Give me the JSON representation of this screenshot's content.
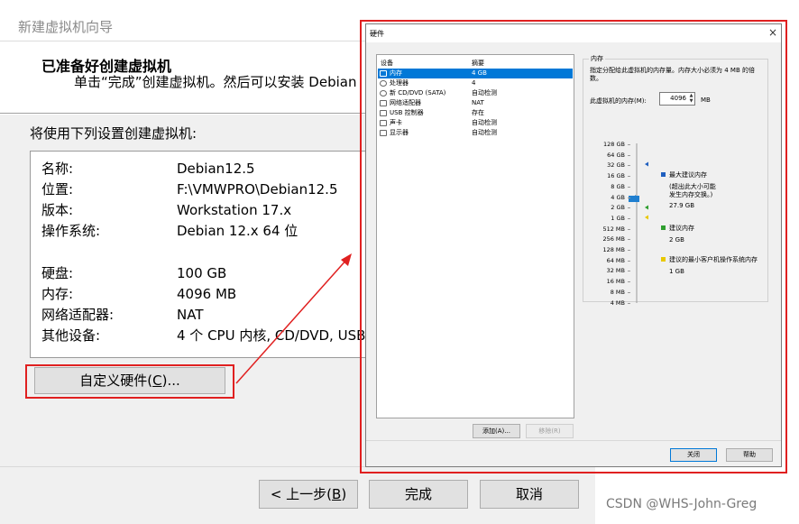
{
  "wizard": {
    "title": "新建虚拟机向导",
    "heading": "已准备好创建虚拟机",
    "subtitle": "单击“完成”创建虚拟机。然后可以安装 Debian",
    "prompt": "将使用下列设置创建虚拟机:",
    "summary": [
      {
        "key": "名称:",
        "value": "Debian12.5"
      },
      {
        "key": "位置:",
        "value": "F:\\VMWPRO\\Debian12.5"
      },
      {
        "key": "版本:",
        "value": "Workstation 17.x"
      },
      {
        "key": "操作系统:",
        "value": "Debian 12.x 64 位"
      },
      {
        "key": "硬盘:",
        "value": "100 GB"
      },
      {
        "key": "内存:",
        "value": "4096 MB"
      },
      {
        "key": "网络适配器:",
        "value": "NAT"
      },
      {
        "key": "其他设备:",
        "value": "4 个 CPU 内核, CD/DVD, USB"
      }
    ],
    "customize_button": {
      "label": "自定义硬件(",
      "mnemonic": "C",
      "suffix": ")..."
    },
    "back_button": {
      "label": "< 上一步(",
      "mnemonic": "B",
      "suffix": ")"
    },
    "finish_button": "完成",
    "cancel_button": "取消"
  },
  "watermark": "CSDN @WHS-John-Greg",
  "hardware_dialog": {
    "title": "硬件",
    "close_glyph": "×",
    "columns": {
      "device": "设备",
      "summary": "摘要"
    },
    "devices": [
      {
        "name": "内存",
        "summary": "4 GB",
        "icon": "memory-icon",
        "selected": true
      },
      {
        "name": "处理器",
        "summary": "4",
        "icon": "cpu-icon",
        "selected": false
      },
      {
        "name": "新 CD/DVD (SATA)",
        "summary": "自动检测",
        "icon": "cd-icon",
        "selected": false
      },
      {
        "name": "网络适配器",
        "summary": "NAT",
        "icon": "network-icon",
        "selected": false
      },
      {
        "name": "USB 控制器",
        "summary": "存在",
        "icon": "usb-icon",
        "selected": false
      },
      {
        "name": "声卡",
        "summary": "自动检测",
        "icon": "speaker-icon",
        "selected": false
      },
      {
        "name": "显示器",
        "summary": "自动检测",
        "icon": "monitor-icon",
        "selected": false
      }
    ],
    "add_button": "添加(A)...",
    "remove_button": "移除(R)",
    "memory": {
      "group_label": "内存",
      "description": "指定分配给此虚拟机的内存量。内存大小必须为 4 MB 的倍数。",
      "field_label": "此虚拟机的内存(M):",
      "value": "4096",
      "unit": "MB",
      "scale_labels": [
        "128 GB",
        "64 GB",
        "32 GB",
        "16 GB",
        "8 GB",
        "4 GB",
        "2 GB",
        "1 GB",
        "512 MB",
        "256 MB",
        "128 MB",
        "64 MB",
        "32 MB",
        "16 MB",
        "8 MB",
        "4 MB"
      ],
      "slider_level": "4 GB",
      "max_recommended": {
        "label": "最大建议内存",
        "note": "(超出此大小可能\n发生内存交换。)",
        "value": "27.9 GB",
        "color": "#1f5fbf"
      },
      "recommended": {
        "label": "建议内存",
        "value": "2 GB",
        "color": "#2e9e2e"
      },
      "guest_min": {
        "label": "建议的最小客户机操作系统内存",
        "value": "1 GB",
        "color": "#e8c800"
      }
    },
    "close_button": "关闭",
    "help_button": "帮助"
  },
  "colors": {
    "highlight_red": "#e02020",
    "selection_blue": "#0078d7"
  }
}
